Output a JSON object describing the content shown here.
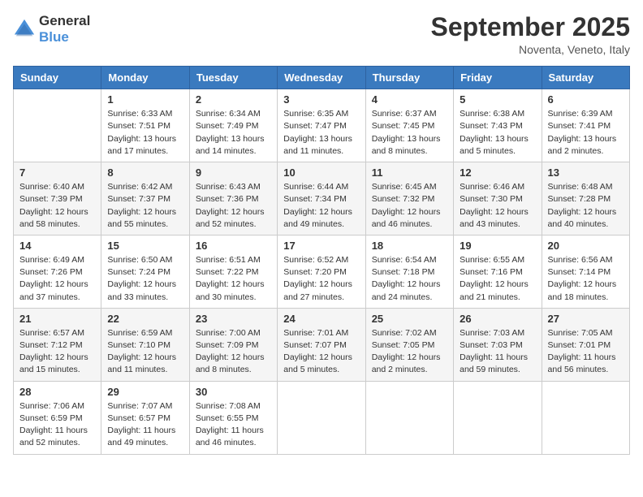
{
  "logo": {
    "general": "General",
    "blue": "Blue"
  },
  "title": "September 2025",
  "location": "Noventa, Veneto, Italy",
  "headers": [
    "Sunday",
    "Monday",
    "Tuesday",
    "Wednesday",
    "Thursday",
    "Friday",
    "Saturday"
  ],
  "weeks": [
    [
      {
        "day": "",
        "sunrise": "",
        "sunset": "",
        "daylight": ""
      },
      {
        "day": "1",
        "sunrise": "Sunrise: 6:33 AM",
        "sunset": "Sunset: 7:51 PM",
        "daylight": "Daylight: 13 hours and 17 minutes."
      },
      {
        "day": "2",
        "sunrise": "Sunrise: 6:34 AM",
        "sunset": "Sunset: 7:49 PM",
        "daylight": "Daylight: 13 hours and 14 minutes."
      },
      {
        "day": "3",
        "sunrise": "Sunrise: 6:35 AM",
        "sunset": "Sunset: 7:47 PM",
        "daylight": "Daylight: 13 hours and 11 minutes."
      },
      {
        "day": "4",
        "sunrise": "Sunrise: 6:37 AM",
        "sunset": "Sunset: 7:45 PM",
        "daylight": "Daylight: 13 hours and 8 minutes."
      },
      {
        "day": "5",
        "sunrise": "Sunrise: 6:38 AM",
        "sunset": "Sunset: 7:43 PM",
        "daylight": "Daylight: 13 hours and 5 minutes."
      },
      {
        "day": "6",
        "sunrise": "Sunrise: 6:39 AM",
        "sunset": "Sunset: 7:41 PM",
        "daylight": "Daylight: 13 hours and 2 minutes."
      }
    ],
    [
      {
        "day": "7",
        "sunrise": "Sunrise: 6:40 AM",
        "sunset": "Sunset: 7:39 PM",
        "daylight": "Daylight: 12 hours and 58 minutes."
      },
      {
        "day": "8",
        "sunrise": "Sunrise: 6:42 AM",
        "sunset": "Sunset: 7:37 PM",
        "daylight": "Daylight: 12 hours and 55 minutes."
      },
      {
        "day": "9",
        "sunrise": "Sunrise: 6:43 AM",
        "sunset": "Sunset: 7:36 PM",
        "daylight": "Daylight: 12 hours and 52 minutes."
      },
      {
        "day": "10",
        "sunrise": "Sunrise: 6:44 AM",
        "sunset": "Sunset: 7:34 PM",
        "daylight": "Daylight: 12 hours and 49 minutes."
      },
      {
        "day": "11",
        "sunrise": "Sunrise: 6:45 AM",
        "sunset": "Sunset: 7:32 PM",
        "daylight": "Daylight: 12 hours and 46 minutes."
      },
      {
        "day": "12",
        "sunrise": "Sunrise: 6:46 AM",
        "sunset": "Sunset: 7:30 PM",
        "daylight": "Daylight: 12 hours and 43 minutes."
      },
      {
        "day": "13",
        "sunrise": "Sunrise: 6:48 AM",
        "sunset": "Sunset: 7:28 PM",
        "daylight": "Daylight: 12 hours and 40 minutes."
      }
    ],
    [
      {
        "day": "14",
        "sunrise": "Sunrise: 6:49 AM",
        "sunset": "Sunset: 7:26 PM",
        "daylight": "Daylight: 12 hours and 37 minutes."
      },
      {
        "day": "15",
        "sunrise": "Sunrise: 6:50 AM",
        "sunset": "Sunset: 7:24 PM",
        "daylight": "Daylight: 12 hours and 33 minutes."
      },
      {
        "day": "16",
        "sunrise": "Sunrise: 6:51 AM",
        "sunset": "Sunset: 7:22 PM",
        "daylight": "Daylight: 12 hours and 30 minutes."
      },
      {
        "day": "17",
        "sunrise": "Sunrise: 6:52 AM",
        "sunset": "Sunset: 7:20 PM",
        "daylight": "Daylight: 12 hours and 27 minutes."
      },
      {
        "day": "18",
        "sunrise": "Sunrise: 6:54 AM",
        "sunset": "Sunset: 7:18 PM",
        "daylight": "Daylight: 12 hours and 24 minutes."
      },
      {
        "day": "19",
        "sunrise": "Sunrise: 6:55 AM",
        "sunset": "Sunset: 7:16 PM",
        "daylight": "Daylight: 12 hours and 21 minutes."
      },
      {
        "day": "20",
        "sunrise": "Sunrise: 6:56 AM",
        "sunset": "Sunset: 7:14 PM",
        "daylight": "Daylight: 12 hours and 18 minutes."
      }
    ],
    [
      {
        "day": "21",
        "sunrise": "Sunrise: 6:57 AM",
        "sunset": "Sunset: 7:12 PM",
        "daylight": "Daylight: 12 hours and 15 minutes."
      },
      {
        "day": "22",
        "sunrise": "Sunrise: 6:59 AM",
        "sunset": "Sunset: 7:10 PM",
        "daylight": "Daylight: 12 hours and 11 minutes."
      },
      {
        "day": "23",
        "sunrise": "Sunrise: 7:00 AM",
        "sunset": "Sunset: 7:09 PM",
        "daylight": "Daylight: 12 hours and 8 minutes."
      },
      {
        "day": "24",
        "sunrise": "Sunrise: 7:01 AM",
        "sunset": "Sunset: 7:07 PM",
        "daylight": "Daylight: 12 hours and 5 minutes."
      },
      {
        "day": "25",
        "sunrise": "Sunrise: 7:02 AM",
        "sunset": "Sunset: 7:05 PM",
        "daylight": "Daylight: 12 hours and 2 minutes."
      },
      {
        "day": "26",
        "sunrise": "Sunrise: 7:03 AM",
        "sunset": "Sunset: 7:03 PM",
        "daylight": "Daylight: 11 hours and 59 minutes."
      },
      {
        "day": "27",
        "sunrise": "Sunrise: 7:05 AM",
        "sunset": "Sunset: 7:01 PM",
        "daylight": "Daylight: 11 hours and 56 minutes."
      }
    ],
    [
      {
        "day": "28",
        "sunrise": "Sunrise: 7:06 AM",
        "sunset": "Sunset: 6:59 PM",
        "daylight": "Daylight: 11 hours and 52 minutes."
      },
      {
        "day": "29",
        "sunrise": "Sunrise: 7:07 AM",
        "sunset": "Sunset: 6:57 PM",
        "daylight": "Daylight: 11 hours and 49 minutes."
      },
      {
        "day": "30",
        "sunrise": "Sunrise: 7:08 AM",
        "sunset": "Sunset: 6:55 PM",
        "daylight": "Daylight: 11 hours and 46 minutes."
      },
      {
        "day": "",
        "sunrise": "",
        "sunset": "",
        "daylight": ""
      },
      {
        "day": "",
        "sunrise": "",
        "sunset": "",
        "daylight": ""
      },
      {
        "day": "",
        "sunrise": "",
        "sunset": "",
        "daylight": ""
      },
      {
        "day": "",
        "sunrise": "",
        "sunset": "",
        "daylight": ""
      }
    ]
  ]
}
